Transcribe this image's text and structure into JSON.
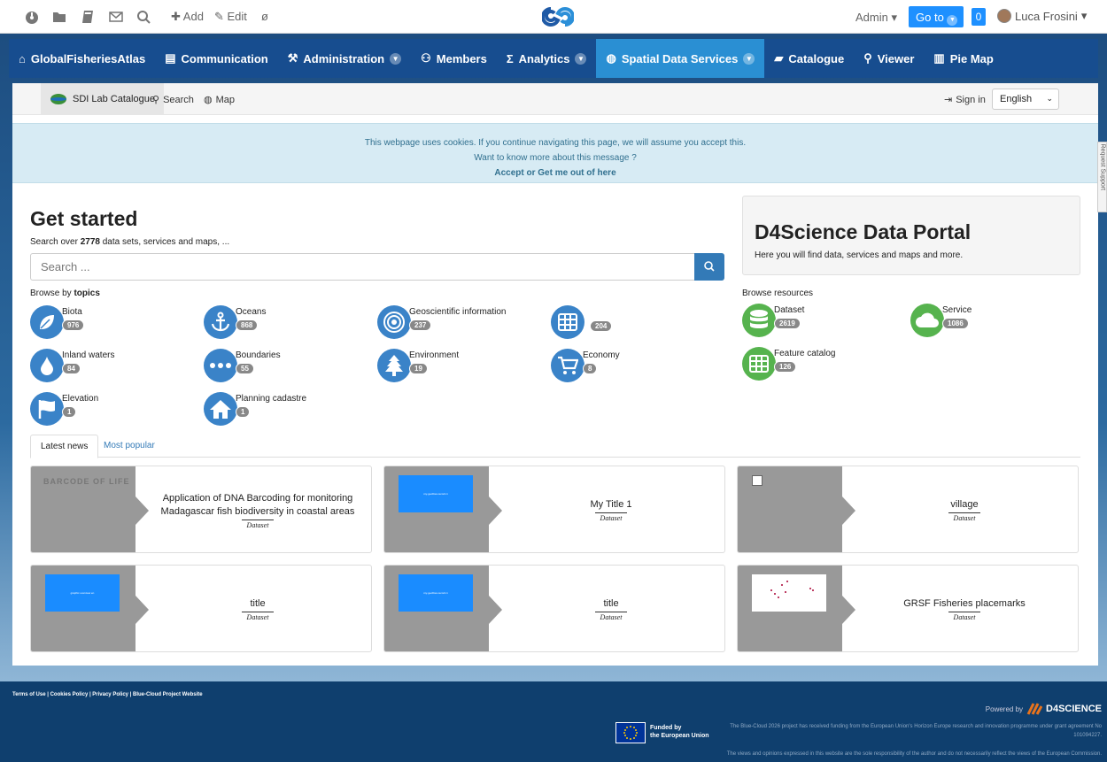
{
  "topbar": {
    "icons": [
      "dashboard-icon",
      "folder-icon",
      "book-icon",
      "mail-icon",
      "search-icon"
    ],
    "add_label": "Add",
    "edit_label": "Edit",
    "admin_label": "Admin",
    "goto_label": "Go to",
    "notification_count": "0",
    "user_name": "Luca Frosini"
  },
  "navbar": {
    "items": [
      {
        "label": "GlobalFisheriesAtlas",
        "icon": "home-icon"
      },
      {
        "label": "Communication",
        "icon": "chat-icon"
      },
      {
        "label": "Administration",
        "icon": "wrench-icon",
        "dropdown": true
      },
      {
        "label": "Members",
        "icon": "users-icon"
      },
      {
        "label": "Analytics",
        "icon": "sigma-icon",
        "dropdown": true
      },
      {
        "label": "Spatial Data Services",
        "icon": "globe-icon",
        "dropdown": true,
        "active": true
      },
      {
        "label": "Catalogue",
        "icon": "book-icon"
      },
      {
        "label": "Viewer",
        "icon": "search-icon"
      },
      {
        "label": "Pie Map",
        "icon": "map-icon"
      }
    ],
    "colors": {
      "bar": "#174d8f",
      "active": "#2a8fd3"
    }
  },
  "subnav": {
    "catalogue_label": "SDI Lab Catalogue",
    "search_label": "Search",
    "map_label": "Map",
    "signin_label": "Sign in",
    "language": "English"
  },
  "cookie": {
    "line1": "This webpage uses cookies. If you continue navigating this page, we will assume you accept this.",
    "line2": "Want to know more about this message ?",
    "accept": "Accept",
    "or": "or",
    "leave": "Get me out of here"
  },
  "hero": {
    "title": "Get started",
    "search_prefix": "Search over ",
    "search_count": "2778",
    "search_suffix": " data sets, services and maps, ...",
    "search_placeholder": "Search ..."
  },
  "topics": {
    "heading_prefix": "Browse by ",
    "heading_bold": "topics",
    "items": [
      {
        "label": "Biota",
        "count": "976",
        "icon": "leaf-icon"
      },
      {
        "label": "Oceans",
        "count": "868",
        "icon": "anchor-icon"
      },
      {
        "label": "Geoscientific information",
        "count": "237",
        "icon": "target-icon"
      },
      {
        "label": "",
        "count": "204",
        "icon": "table-icon"
      },
      {
        "label": "Inland waters",
        "count": "84",
        "icon": "drop-icon"
      },
      {
        "label": "Boundaries",
        "count": "55",
        "icon": "dots-icon"
      },
      {
        "label": "Environment",
        "count": "19",
        "icon": "tree-icon"
      },
      {
        "label": "Economy",
        "count": "8",
        "icon": "cart-icon"
      },
      {
        "label": "Elevation",
        "count": "1",
        "icon": "flag-icon"
      },
      {
        "label": "Planning cadastre",
        "count": "1",
        "icon": "house-icon"
      }
    ]
  },
  "portal": {
    "title": "D4Science Data Portal",
    "subtitle": "Here you will find data, services and maps and more."
  },
  "resources": {
    "heading": "Browse resources",
    "items": [
      {
        "label": "Dataset",
        "count": "2619",
        "icon": "database-icon"
      },
      {
        "label": "Service",
        "count": "1086",
        "icon": "cloud-icon"
      },
      {
        "label": "Feature catalog",
        "count": "126",
        "icon": "table-icon"
      }
    ]
  },
  "tabs": {
    "latest": "Latest news",
    "popular": "Most popular"
  },
  "cards": [
    {
      "title": "Application of DNA Barcoding for monitoring Madagascar fish biodiversity in coastal areas",
      "type": "Dataset",
      "thumb_text": "BARCODE OF LIFE"
    },
    {
      "title": "My Title 1",
      "type": "Dataset",
      "thumb_text": "my-geoflow-record-1"
    },
    {
      "title": "village",
      "type": "Dataset",
      "thumb_text": ""
    },
    {
      "title": "title",
      "type": "Dataset",
      "thumb_text": "graphic overview en"
    },
    {
      "title": "title",
      "type": "Dataset",
      "thumb_text": "my-geoflow-record-1"
    },
    {
      "title": "GRSF Fisheries placemarks",
      "type": "Dataset",
      "thumb_text": ""
    }
  ],
  "support_tab": "Request Support",
  "footer": {
    "links": [
      "Terms of Use",
      "Cookies Policy",
      "Privacy Policy",
      "Blue-Cloud Project Website"
    ],
    "powered_by": "Powered by",
    "brand": "D4SCIENCE",
    "funded_line1": "Funded by",
    "funded_line2": "the European Union",
    "grant": "The Blue-Cloud 2026 project has received funding from the European Union's Horizon Europe research and innovation programme under grant agreement No 101094227.",
    "disclaimer": "The views and opinions expressed in this website are the sole responsibility of the author and do not necessarily reflect the views of the European Commission."
  }
}
